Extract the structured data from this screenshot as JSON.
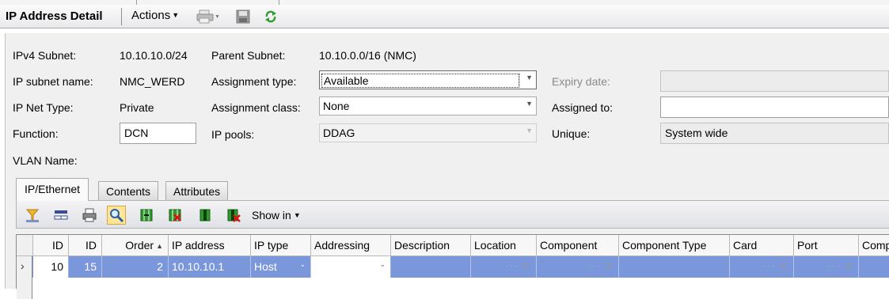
{
  "header": {
    "title": "IP Address Detail",
    "actions_label": "Actions"
  },
  "form": {
    "ipv4_subnet": {
      "label": "IPv4 Subnet:",
      "value": "10.10.10.0/24"
    },
    "parent_subnet": {
      "label": "Parent Subnet:",
      "value": "10.10.0.0/16 (NMC)"
    },
    "ip_subnet_name": {
      "label": "IP subnet name:",
      "value": "NMC_WERD"
    },
    "assignment_type": {
      "label": "Assignment type:",
      "value": "Available"
    },
    "expiry_date": {
      "label": "Expiry date:",
      "value": ""
    },
    "ip_net_type": {
      "label": "IP Net Type:",
      "value": "Private"
    },
    "assignment_class": {
      "label": "Assignment class:",
      "value": "None"
    },
    "assigned_to": {
      "label": "Assigned to:",
      "value": ""
    },
    "function": {
      "label": "Function:",
      "value": "DCN"
    },
    "ip_pools": {
      "label": "IP pools:",
      "value": "DDAG"
    },
    "unique": {
      "label": "Unique:",
      "value": "System wide"
    },
    "vlan_name": {
      "label": "VLAN Name:",
      "value": ""
    }
  },
  "tabs": [
    {
      "label": "IP/Ethernet",
      "active": true
    },
    {
      "label": "Contents",
      "active": false
    },
    {
      "label": "Attributes",
      "active": false
    }
  ],
  "grid_toolbar": {
    "show_in_label": "Show in",
    "icons": [
      "filter-icon",
      "fields-icon",
      "print-icon",
      "find-icon",
      "map-columns-icon",
      "remove-columns-icon",
      "add-row-icon",
      "delete-row-icon"
    ]
  },
  "table": {
    "columns": [
      "ID",
      "ID",
      "Order",
      "IP address",
      "IP type",
      "Addressing",
      "Description",
      "Location",
      "Component",
      "Component Type",
      "Card",
      "Port",
      "Comp"
    ],
    "sort_column": "Order",
    "rows": [
      {
        "id1": "10",
        "id2": "15",
        "order": "2",
        "ip_address": "10.10.10.1",
        "ip_type": "Host",
        "addressing": "",
        "description": "",
        "location": "",
        "component": "",
        "component_type": "",
        "card": "",
        "port": "",
        "comp": ""
      }
    ]
  },
  "colors": {
    "selection": "#7b97dc",
    "panel": "#f0f0f0",
    "pressed": "#fde69a"
  }
}
